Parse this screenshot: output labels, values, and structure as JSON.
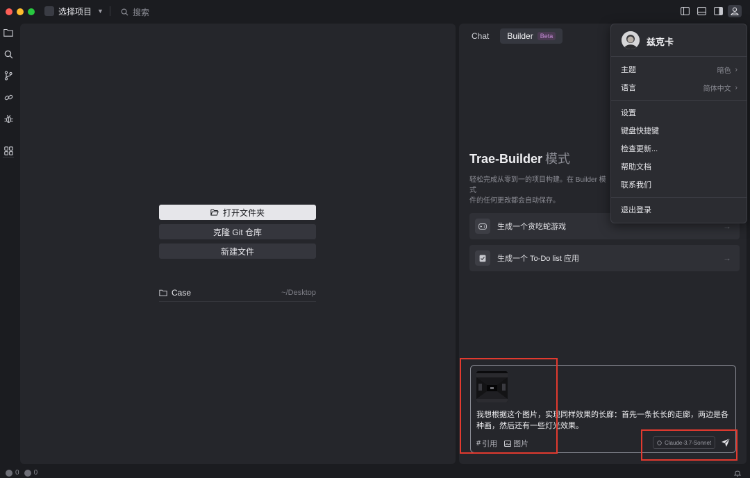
{
  "titlebar": {
    "project_label": "选择项目",
    "search_placeholder": "搜索"
  },
  "editor": {
    "open_folder": "打开文件夹",
    "clone_repo": "克隆 Git 仓库",
    "new_file": "新建文件",
    "recent": [
      {
        "name": "Case",
        "path": "~/Desktop"
      }
    ]
  },
  "panel": {
    "tabs": [
      {
        "label": "Chat",
        "active": false
      },
      {
        "label": "Builder",
        "active": true,
        "badge": "Beta"
      }
    ],
    "title": "Trae-Builder",
    "title_suffix": "模式",
    "description": "轻松完成从零到一的项目构建。在 Builder 模式件的任何更改都会自动保存。",
    "description_line1": "轻松完成从零到一的项目构建。在 Builder 模式",
    "description_line2": "件的任何更改都会自动保存。",
    "suggestions": [
      {
        "label": "生成一个贪吃蛇游戏",
        "icon": "gamepad-icon"
      },
      {
        "label": "生成一个 To-Do list 应用",
        "icon": "checklist-icon"
      }
    ],
    "chat": {
      "message": "我想根据这个图片，实现同样效果的长廊：首先一条长长的走廊，两边是各种画，然后还有一些灯光效果。",
      "tool_reference": "引用",
      "tool_image": "图片",
      "model": "Claude-3.7-Sonnet"
    }
  },
  "user_menu": {
    "username": "兹克卡",
    "items": [
      {
        "label": "主题",
        "value": "暗色",
        "submenu": true
      },
      {
        "label": "语言",
        "value": "简体中文",
        "submenu": true
      },
      {
        "label": "设置"
      },
      {
        "label": "键盘快捷键"
      },
      {
        "label": "检查更新..."
      },
      {
        "label": "帮助文档"
      },
      {
        "label": "联系我们"
      },
      {
        "label": "退出登录"
      }
    ]
  },
  "statusbar": {
    "errors": "0",
    "warnings": "0"
  },
  "colors": {
    "background": "#1b1c20",
    "panel": "#25262b",
    "menu": "#2b2c31",
    "highlight_box": "#e23a2f",
    "beta_badge": "#c58bd6"
  }
}
